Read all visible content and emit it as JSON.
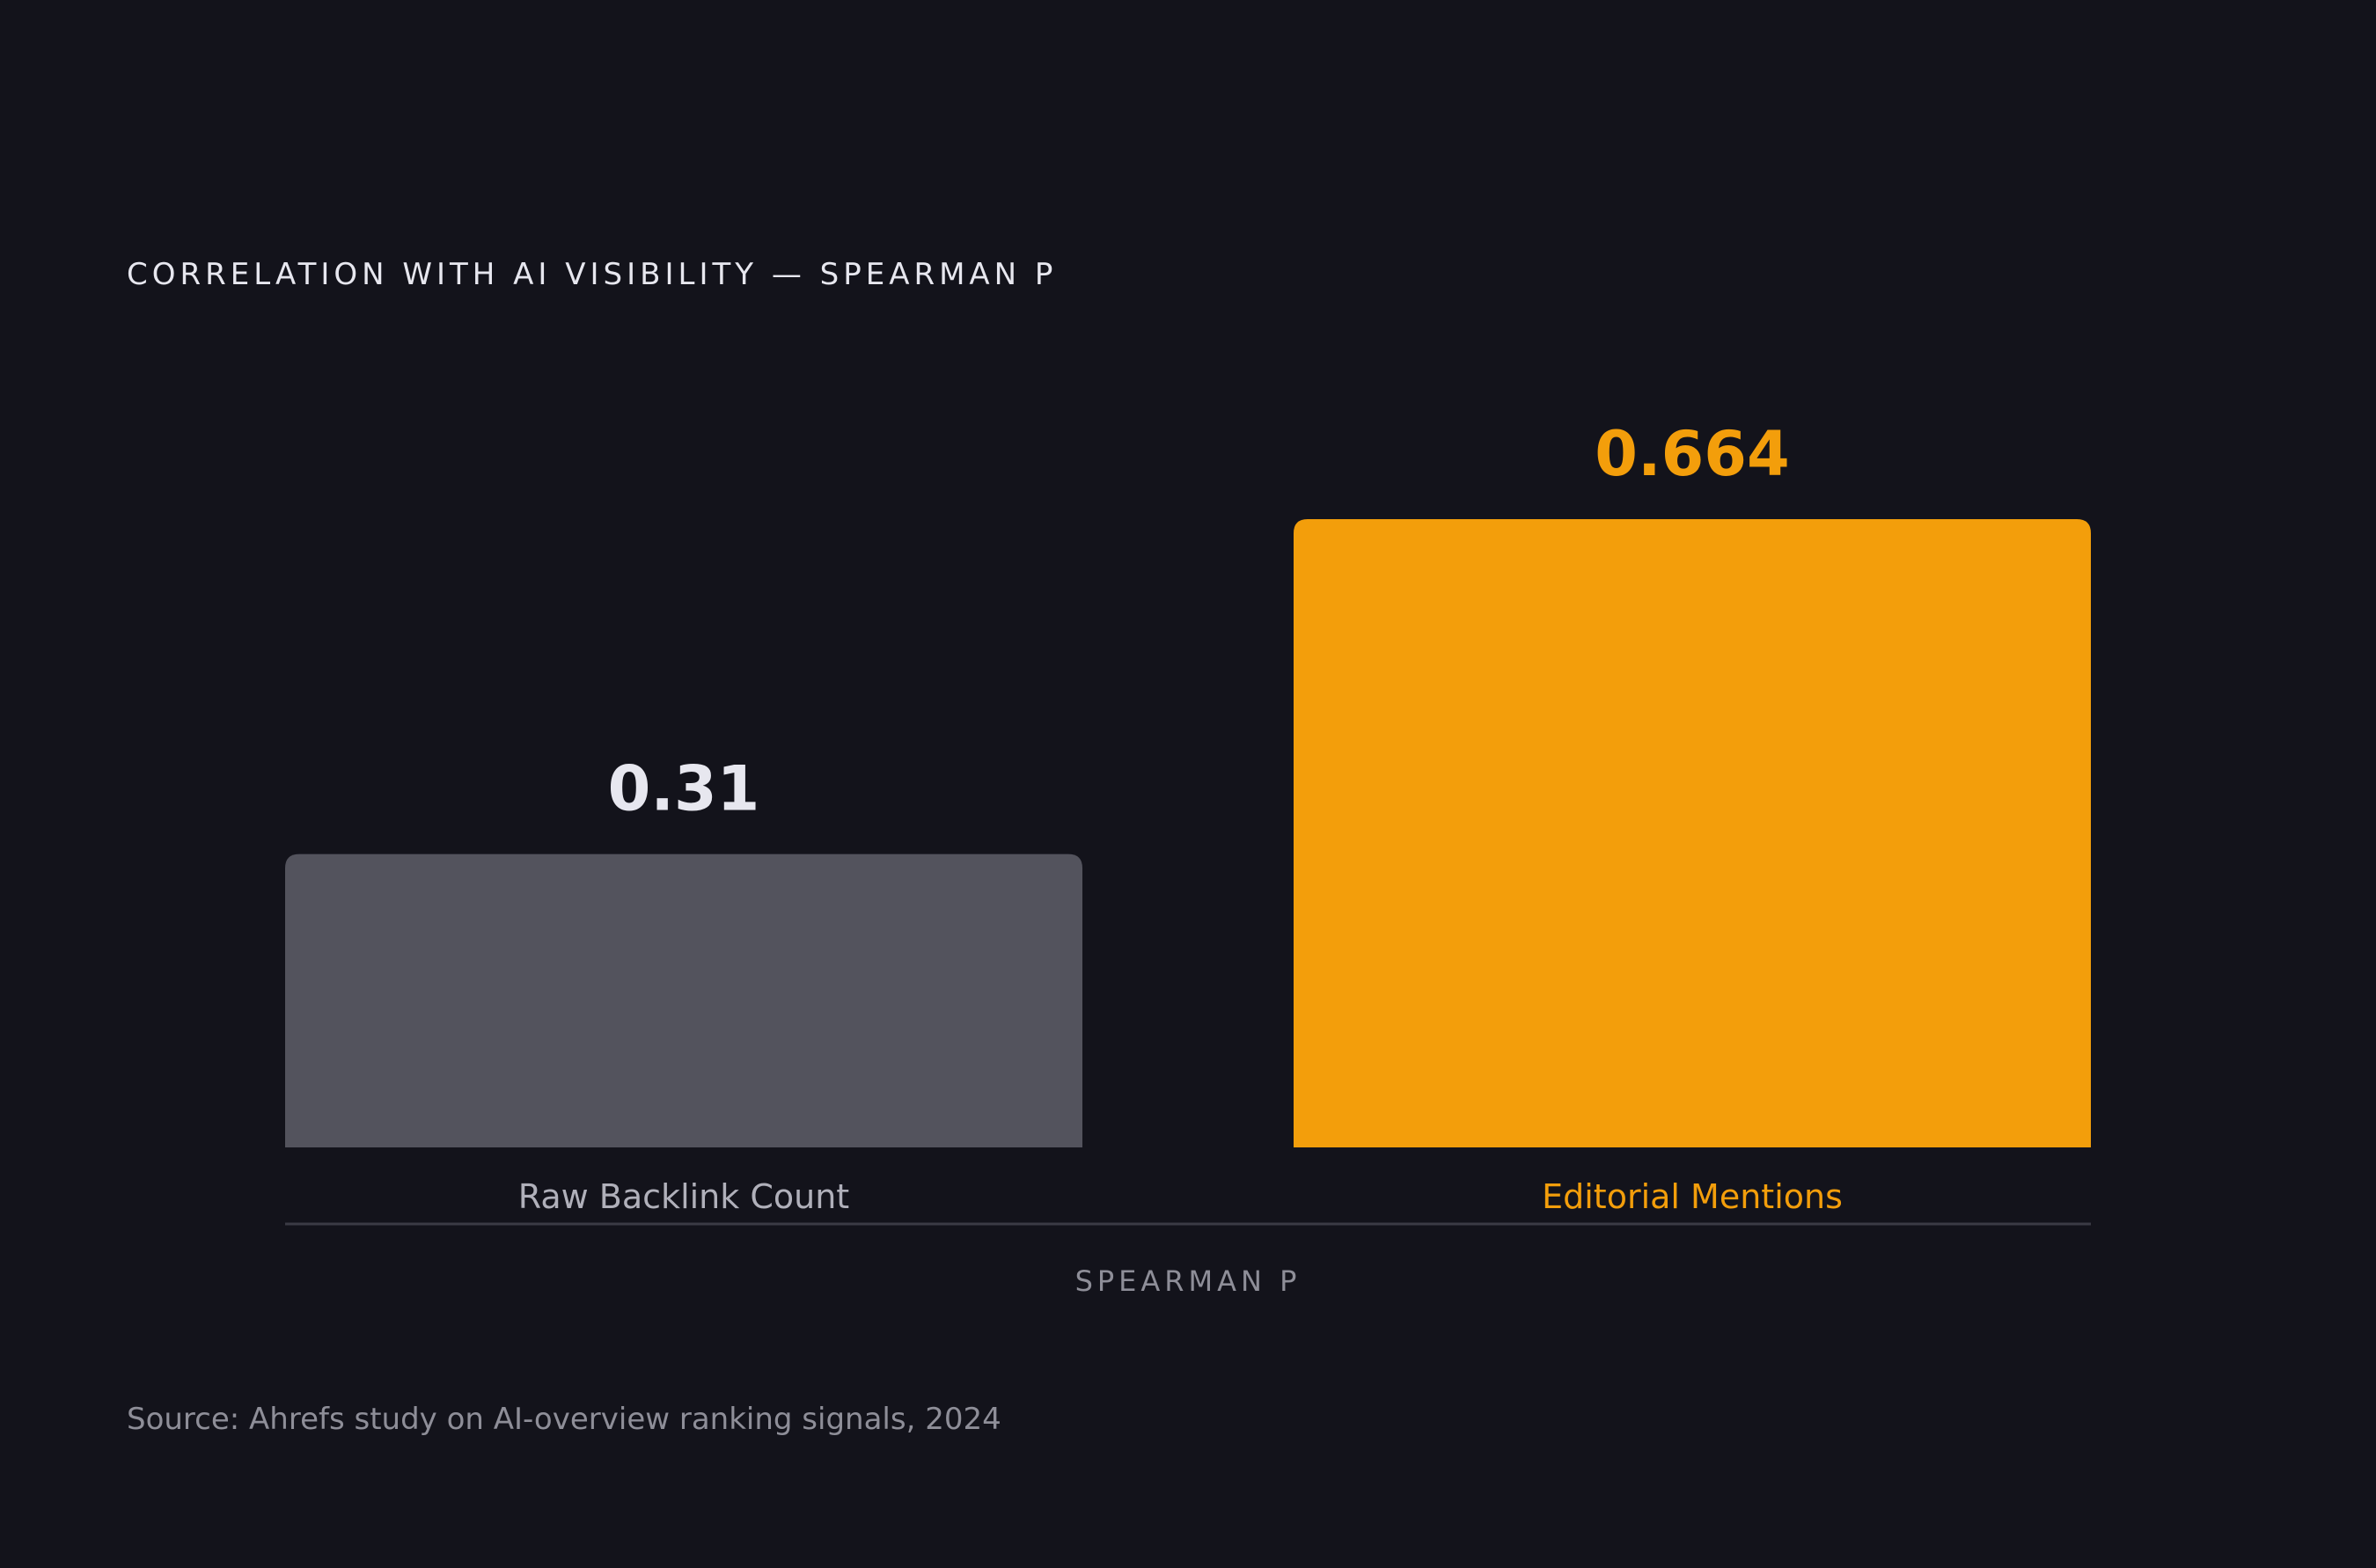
{
  "chart_data": {
    "type": "bar",
    "title": "CORRELATION WITH AI VISIBILITY — SPEARMAN Ρ",
    "xlabel": "SPEARMAN Ρ",
    "ylabel": "",
    "categories": [
      "Raw Backlink Count",
      "Editorial Mentions"
    ],
    "values": [
      0.31,
      0.664
    ],
    "value_labels": [
      "0.31",
      "0.664"
    ],
    "ylim": [
      0,
      0.664
    ],
    "grid": false,
    "colors": {
      "bars": [
        "#53535d",
        "#f39e0b"
      ],
      "value_labels": [
        "#e7e7ef",
        "#f39e0b"
      ],
      "category_labels": [
        "#b0b0ba",
        "#f39e0b"
      ],
      "axis_line": "#3b3b45",
      "background": "#13131b"
    }
  },
  "source": "Source: Ahrefs study on AI-overview ranking signals, 2024"
}
